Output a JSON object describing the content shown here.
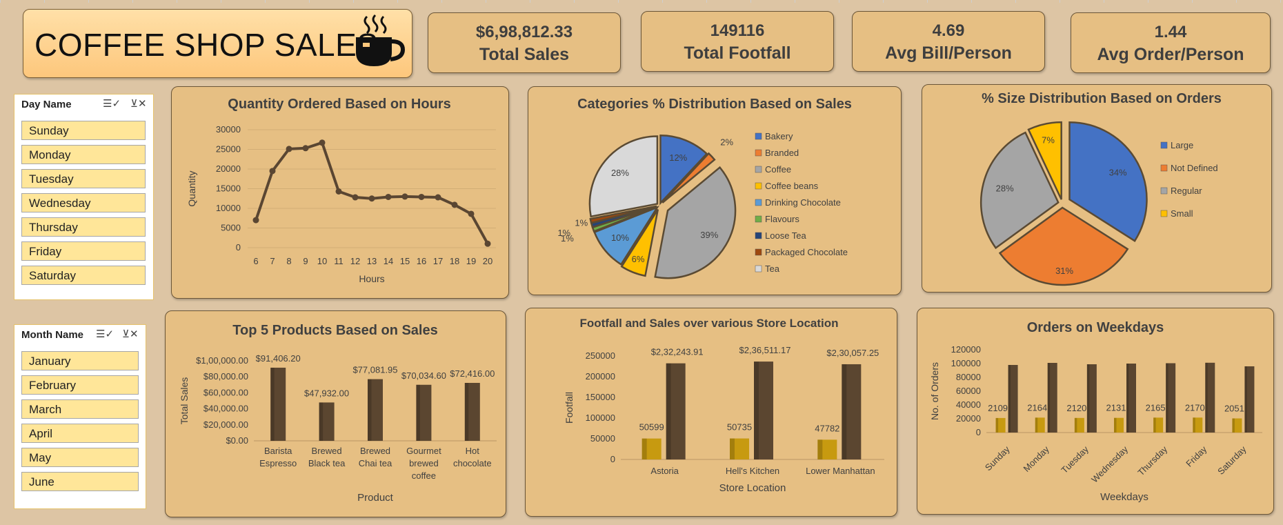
{
  "header": {
    "title": "COFFEE SHOP SALES",
    "icon": "coffee-cup-icon"
  },
  "kpis": [
    {
      "value": "$6,98,812.33",
      "label": "Total Sales"
    },
    {
      "value": "149116",
      "label": "Total Footfall"
    },
    {
      "value": "4.69",
      "label": "Avg Bill/Person"
    },
    {
      "value": "1.44",
      "label": "Avg Order/Person"
    }
  ],
  "slicers": {
    "day": {
      "title": "Day Name",
      "items": [
        "Sunday",
        "Monday",
        "Tuesday",
        "Wednesday",
        "Thursday",
        "Friday",
        "Saturday"
      ]
    },
    "month": {
      "title": "Month Name",
      "items": [
        "January",
        "February",
        "March",
        "April",
        "May",
        "June"
      ]
    }
  },
  "colors": {
    "line": "#5a4632",
    "bar_dark": "#5b4630",
    "bar_gold": "#c79a10",
    "pie_blue": "#4472c4",
    "pie_orange": "#ed7d31",
    "pie_gray": "#a5a5a5",
    "pie_yellow": "#ffc000",
    "pie_lightblue": "#5b9bd5",
    "pie_green": "#70ad47",
    "pie_navy": "#264478",
    "pie_brown": "#9e480e",
    "pie_light": "#d9d9d9"
  },
  "chart_data": [
    {
      "type": "line",
      "title": "Quantity Ordered Based on Hours",
      "xlabel": "Hours",
      "ylabel": "Quantity",
      "x": [
        6,
        7,
        8,
        9,
        10,
        11,
        12,
        13,
        14,
        15,
        16,
        17,
        18,
        19,
        20
      ],
      "values": [
        7000,
        19500,
        25100,
        25300,
        26700,
        14300,
        12800,
        12500,
        12900,
        13000,
        12900,
        12800,
        10900,
        8600,
        1000
      ],
      "ylim": [
        0,
        30000
      ],
      "yticks": [
        "0",
        "5000",
        "10000",
        "15000",
        "20000",
        "25000",
        "30000"
      ],
      "grid": true
    },
    {
      "type": "pie",
      "title": "Categories % Distribution Based on Sales",
      "categories": [
        "Bakery",
        "Branded",
        "Coffee",
        "Coffee beans",
        "Drinking Chocolate",
        "Flavours",
        "Loose Tea",
        "Packaged Chocolate",
        "Tea"
      ],
      "values": [
        12,
        2,
        39,
        6,
        10,
        1,
        1,
        1,
        28
      ],
      "labels": [
        "12%",
        "2%",
        "39%",
        "6%",
        "10%",
        "1%",
        "1%",
        "1%",
        "28%"
      ],
      "legend": "right"
    },
    {
      "type": "pie",
      "title": "% Size Distribution Based on Orders",
      "categories": [
        "Large",
        "Not Defined",
        "Regular",
        "Small"
      ],
      "values": [
        34,
        31,
        28,
        7
      ],
      "labels": [
        "34%",
        "31%",
        "28%",
        "7%"
      ],
      "legend": "right"
    },
    {
      "type": "bar",
      "title": "Top 5 Products Based on Sales",
      "xlabel": "Product",
      "ylabel": "Total Sales",
      "categories": [
        [
          "Barista",
          "Espresso"
        ],
        [
          "Brewed",
          "Black tea"
        ],
        [
          "Brewed",
          "Chai tea"
        ],
        [
          "Gourmet",
          "brewed",
          "coffee"
        ],
        [
          "Hot",
          "chocolate"
        ]
      ],
      "values": [
        91406.2,
        47932.0,
        77081.95,
        70034.6,
        72416.0
      ],
      "data_labels": [
        "$91,406.20",
        "$47,932.00",
        "$77,081.95",
        "$70,034.60",
        "$72,416.00"
      ],
      "ylim": [
        0,
        100000
      ],
      "yticks": [
        "$0.00",
        "$20,000.00",
        "$40,000.00",
        "$60,000.00",
        "$80,000.00",
        "$1,00,000.00"
      ]
    },
    {
      "type": "bar",
      "title": "Footfall and Sales  over various Store Location",
      "xlabel": "Store Location",
      "ylabel": "Footfall",
      "categories": [
        "Astoria",
        "Hell's Kitchen",
        "Lower Manhattan"
      ],
      "series": [
        {
          "values": [
            50599,
            50735,
            47782
          ],
          "data_labels": [
            "50599",
            "50735",
            "47782"
          ]
        },
        {
          "values": [
            232243.91,
            236511.17,
            230057.25
          ],
          "data_labels": [
            "$2,32,243.91",
            "$2,36,511.17",
            "$2,30,057.25"
          ]
        }
      ],
      "ylim": [
        0,
        250000
      ],
      "yticks": [
        "0",
        "50000",
        "100000",
        "150000",
        "200000",
        "250000"
      ]
    },
    {
      "type": "bar",
      "title": "Orders on Weekdays",
      "xlabel": "Weekdays",
      "ylabel": "No. of Orders",
      "categories": [
        "Sunday",
        "Monday",
        "Tuesday",
        "Wednesday",
        "Thursday",
        "Friday",
        "Saturday"
      ],
      "series": [
        {
          "values": [
            21096,
            21643,
            21202,
            21310,
            21654,
            21701,
            20510
          ],
          "data_labels": [
            "2109",
            "2164",
            "2120",
            "2131",
            "2165",
            "2170",
            "2051"
          ]
        },
        {
          "values": [
            98000,
            101000,
            99000,
            100000,
            100500,
            101200,
            96000
          ]
        }
      ],
      "ylim": [
        0,
        120000
      ],
      "yticks": [
        "0",
        "20000",
        "40000",
        "60000",
        "80000",
        "100000",
        "120000"
      ]
    }
  ]
}
